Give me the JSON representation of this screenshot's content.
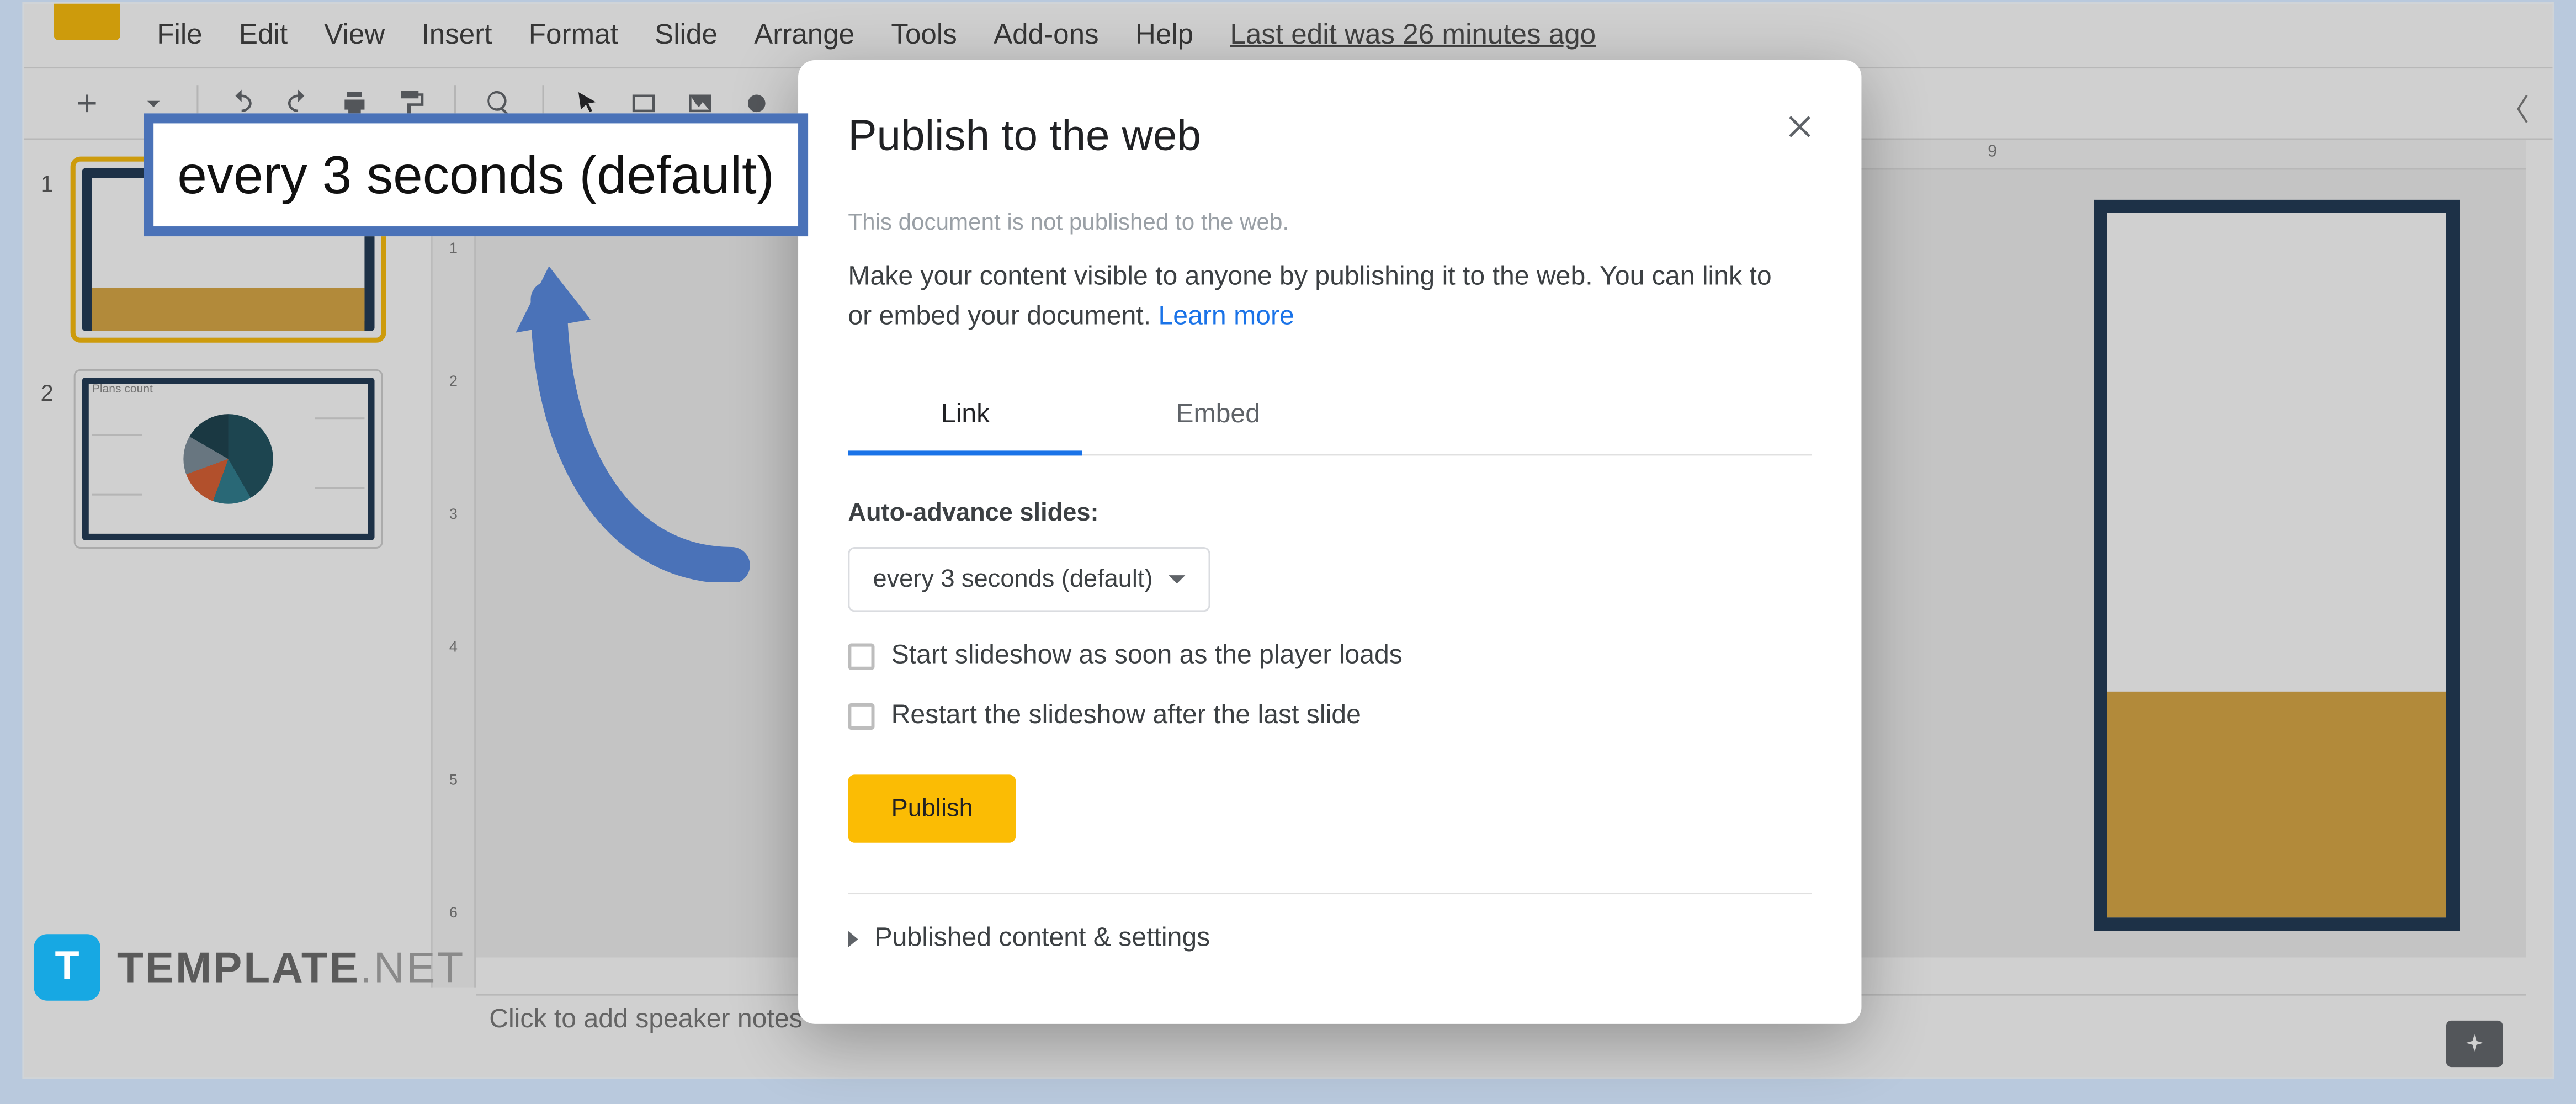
{
  "menubar": {
    "items": [
      "File",
      "Edit",
      "View",
      "Insert",
      "Format",
      "Slide",
      "Arrange",
      "Tools",
      "Add-ons",
      "Help"
    ],
    "edit_status": "Last edit was 26 minutes ago"
  },
  "slide_thumbs": {
    "n1": "1",
    "n2": "2",
    "mini_title": "Plans count"
  },
  "ruler": {
    "htick9": "9",
    "vticks": [
      "1",
      "2",
      "3",
      "4",
      "5",
      "6"
    ]
  },
  "speakers_placeholder": "Click to add speaker notes",
  "dialog": {
    "title": "Publish to the web",
    "sub": "This document is not published to the web.",
    "desc_a": "Make your content visible to anyone by publishing it to the web. You can link to or embed your document. ",
    "learn": "Learn more",
    "tabs": {
      "link": "Link",
      "embed": "Embed"
    },
    "section_label": "Auto-advance slides:",
    "dropdown_value": "every 3 seconds (default)",
    "chk1": "Start slideshow as soon as the player loads",
    "chk2": "Restart the slideshow after the last slide",
    "publish": "Publish",
    "expand": "Published content & settings"
  },
  "callout": {
    "text": "every 3 seconds (default)"
  },
  "watermark": {
    "brand": "TEMPLATE",
    "suffix": ".NET",
    "icon": "T"
  }
}
